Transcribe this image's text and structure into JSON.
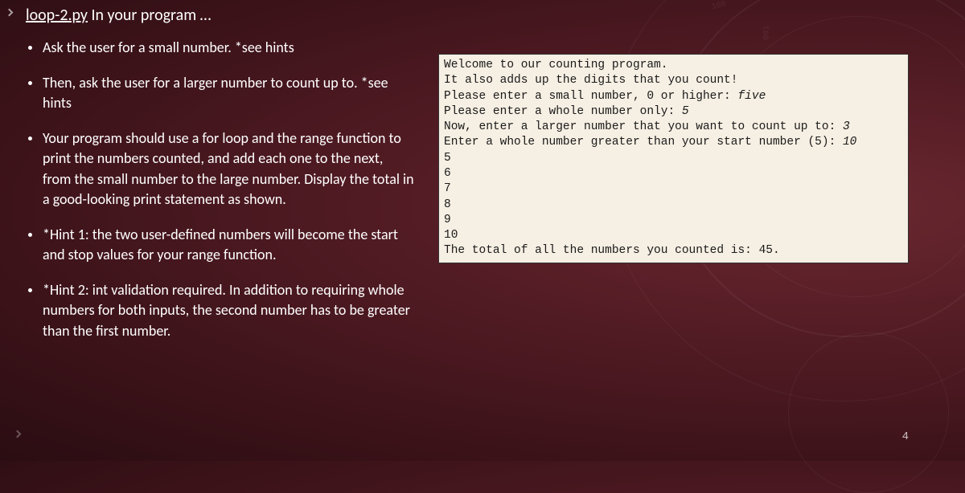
{
  "title": {
    "filename": "loop-2.py",
    "rest": " In your program …"
  },
  "bullets": [
    "Ask the user for a small number.  *see hints",
    "Then, ask the user for a larger number to count up to. *see hints",
    "Your program should use a for loop and the range function to print the numbers counted, and add each one to the next, from the small number to the large number. Display the total in a good-looking print statement as shown.",
    "*Hint 1: the two user-defined numbers will become the start and stop values for your range function.",
    "*Hint 2: int validation required. In addition to requiring whole numbers for both inputs, the second number has to be greater than the first number."
  ],
  "console": {
    "l1": "Welcome to our counting program.",
    "l2": "It also adds up the digits that you count!",
    "l3p": "Please enter a small number, 0 or higher: ",
    "l3i": "five",
    "l4p": "Please enter a whole number only: ",
    "l4i": "5",
    "l5p": "Now, enter a larger number that you want to count up to: ",
    "l5i": "3",
    "l6p": "Enter a whole number greater than your start number (5): ",
    "l6i": "10",
    "l7": "5",
    "l8": "6",
    "l9": "7",
    "l10": "8",
    "l11": "9",
    "l12": "10",
    "l13": "The total of all the numbers you counted is: 45."
  },
  "decor": {
    "n160": "160",
    "n091": "091",
    "slide_num": "4"
  }
}
